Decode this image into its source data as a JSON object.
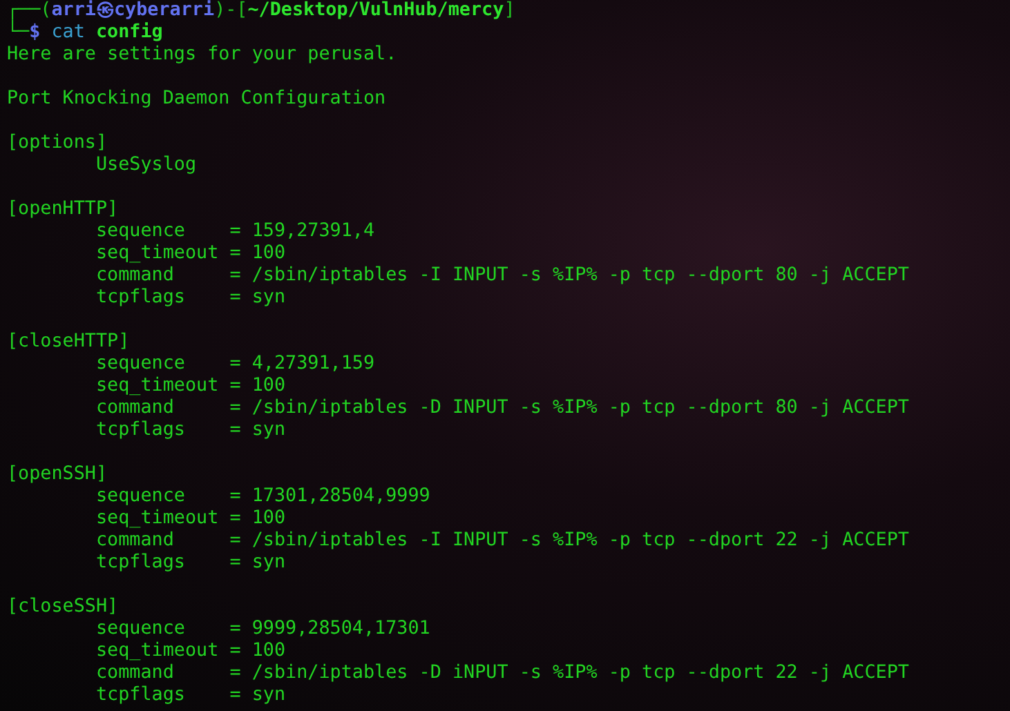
{
  "prompt": {
    "frame_top": "┌──(",
    "user": "arri",
    "at": "㉿",
    "host": "cyberarri",
    "bracket": ")-[",
    "path": "~/Desktop/VulnHub/mercy",
    "close": "]",
    "frame_bottom": "└─",
    "symbol": "$",
    "command": "cat",
    "argument": "config"
  },
  "output": {
    "intro": [
      "Here are settings for your perusal.",
      "Port Knocking Daemon Configuration"
    ],
    "options": {
      "name": "[options]",
      "entries": [
        "UseSyslog"
      ]
    },
    "sections": [
      {
        "name": "[openHTTP]",
        "settings": [
          {
            "key": "sequence",
            "value": "= 159,27391,4"
          },
          {
            "key": "seq_timeout",
            "value": "= 100"
          },
          {
            "key": "command",
            "value": "= /sbin/iptables -I INPUT -s %IP% -p tcp --dport 80 -j ACCEPT"
          },
          {
            "key": "tcpflags",
            "value": "= syn"
          }
        ]
      },
      {
        "name": "[closeHTTP]",
        "settings": [
          {
            "key": "sequence",
            "value": "= 4,27391,159"
          },
          {
            "key": "seq_timeout",
            "value": "= 100"
          },
          {
            "key": "command",
            "value": "= /sbin/iptables -D INPUT -s %IP% -p tcp --dport 80 -j ACCEPT"
          },
          {
            "key": "tcpflags",
            "value": "= syn"
          }
        ]
      },
      {
        "name": "[openSSH]",
        "settings": [
          {
            "key": "sequence",
            "value": "= 17301,28504,9999"
          },
          {
            "key": "seq_timeout",
            "value": "= 100"
          },
          {
            "key": "command",
            "value": "= /sbin/iptables -I INPUT -s %IP% -p tcp --dport 22 -j ACCEPT"
          },
          {
            "key": "tcpflags",
            "value": "= syn"
          }
        ]
      },
      {
        "name": "[closeSSH]",
        "settings": [
          {
            "key": "sequence",
            "value": "= 9999,28504,17301"
          },
          {
            "key": "seq_timeout",
            "value": "= 100"
          },
          {
            "key": "command",
            "value": "= /sbin/iptables -D iNPUT -s %IP% -p tcp --dport 22 -j ACCEPT"
          },
          {
            "key": "tcpflags",
            "value": "= syn"
          }
        ]
      }
    ]
  }
}
